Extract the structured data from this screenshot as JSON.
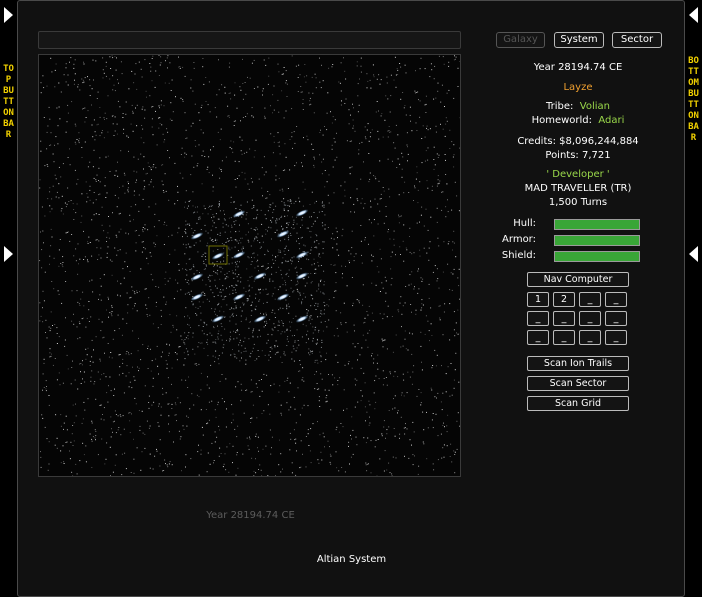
{
  "left_bar": {
    "label": "TOP BUTTON BAR"
  },
  "right_bar": {
    "label": "BOTTOM BUTTON BAR"
  },
  "view_tabs": [
    "Galaxy",
    "System",
    "Sector"
  ],
  "info": {
    "year": "Year 28194.74 CE",
    "player_name": "Layze",
    "tribe_label": "Tribe:",
    "tribe_value": "Volian",
    "homeworld_label": "Homeworld:",
    "homeworld_value": "Adari",
    "credits": "Credits: $8,096,244,884",
    "points": "Points: 7,721",
    "rank": "' Developer '",
    "title": "MAD TRAVELLER (TR)",
    "turns": "1,500 Turns"
  },
  "status": {
    "hull_label": "Hull:",
    "armor_label": "Armor:",
    "shield_label": "Shield:",
    "hull": 1.0,
    "armor": 1.0,
    "shield": 1.0,
    "bar_color": "#39a637"
  },
  "nav": {
    "computer_label": "Nav Computer",
    "slots": [
      "1",
      "2",
      "_",
      "_",
      "_",
      "_",
      "_",
      "_",
      "_",
      "_",
      "_",
      "_"
    ]
  },
  "scan": {
    "ion_trails": "Scan Ion Trails",
    "sector": "Scan Sector",
    "grid": "Scan Grid"
  },
  "footer": {
    "year": "Year 28194.74 CE",
    "system_name": "Altian System"
  },
  "colors": {
    "accent_yellow": "#f0d000",
    "name_orange": "#f0a030",
    "value_green": "#9ad84a",
    "highlight": "#c8c800"
  }
}
